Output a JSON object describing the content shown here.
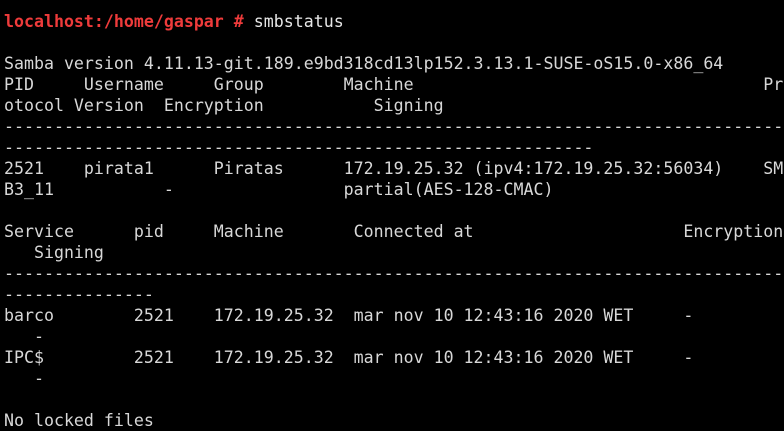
{
  "terminal": {
    "prompt": "localhost:/home/gaspar #",
    "command": " smbstatus",
    "colors": {
      "background": "#000000",
      "text": "#d8d8d8",
      "prompt": "#ef3b3b"
    },
    "lines": [
      "",
      "",
      "Samba version 4.11.13-git.189.e9bd318cd13lp152.3.13.1-SUSE-oS15.0-x86_64",
      "PID     Username     Group        Machine                                   Pr",
      "otocol Version  Encryption           Signing",
      "----------------------------------------------------------------------------------------------------",
      "-----------------------------------------------------------",
      "2521    pirata1      Piratas      172.19.25.32 (ipv4:172.19.25.32:56034)    SM",
      "B3_11           -                 partial(AES-128-CMAC)",
      "",
      "Service      pid     Machine       Connected at                     Encryption",
      "   Signing",
      "----------------------------------------------------------------------------------------------------",
      "---------------",
      "barco        2521    172.19.25.32  mar nov 10 12:43:16 2020 WET     -",
      "   -",
      "IPC$         2521    172.19.25.32  mar nov 10 12:43:16 2020 WET     -",
      "   -",
      "",
      "No locked files"
    ]
  }
}
